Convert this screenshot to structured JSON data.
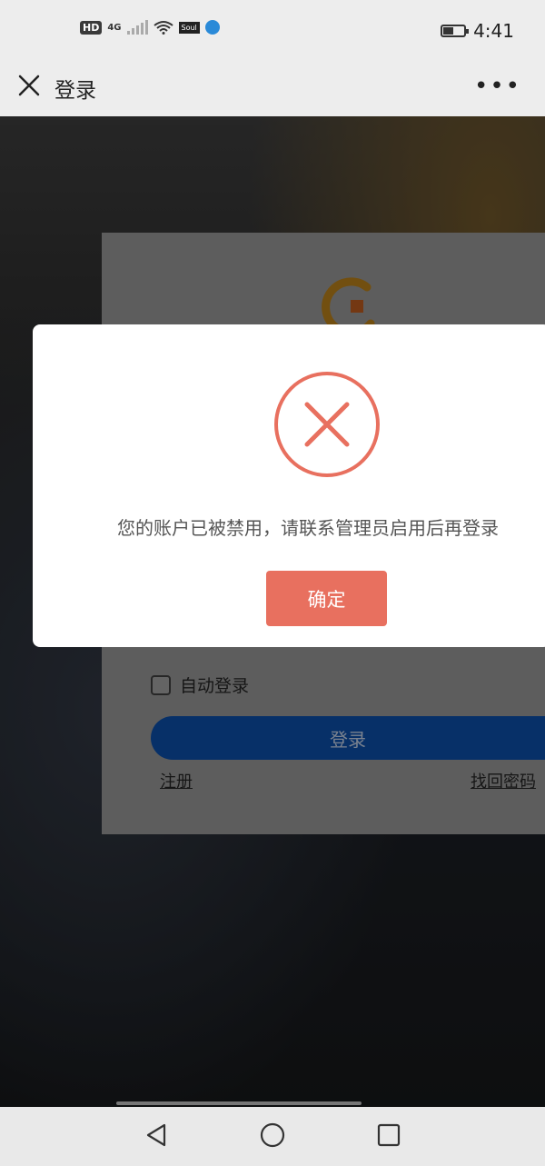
{
  "status_bar": {
    "hd": "HD",
    "network": "4G",
    "soul": "Soul",
    "time": "4:41"
  },
  "title_bar": {
    "title": "登录",
    "more": "•••"
  },
  "login_card": {
    "auto_login_label": "自动登录",
    "login_button": "登录",
    "register_link": "注册",
    "forgot_link": "找回密码"
  },
  "dialog": {
    "message": "您的账户已被禁用，请联系管理员启用后再登录",
    "confirm_button": "确定"
  },
  "colors": {
    "dialog_button": "#e8705f",
    "error_icon": "#e8705f",
    "login_button": "#0b4aa0"
  },
  "icons": {
    "close": "close-icon",
    "more": "more-icon",
    "error": "error-circle-x-icon",
    "back": "back-triangle-icon",
    "home": "home-circle-icon",
    "recent": "recent-square-icon"
  }
}
